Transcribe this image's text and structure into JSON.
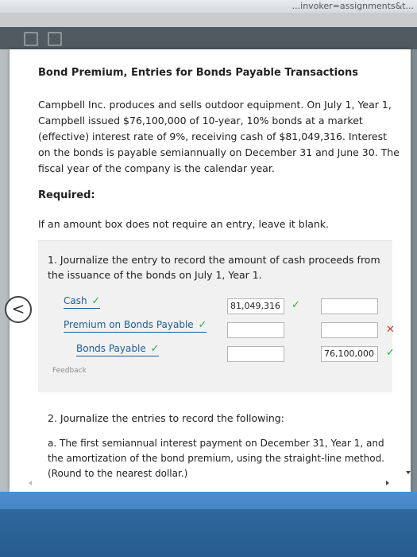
{
  "browser": {
    "url_fragment": "...invoker=assignments&t..."
  },
  "page": {
    "title": "Bond Premium, Entries for Bonds Payable Transactions",
    "problem_text": "Campbell Inc. produces and sells outdoor equipment. On July 1, Year 1, Campbell issued $76,100,000 of 10-year, 10% bonds at a market (effective) interest rate of 9%, receiving cash of $81,049,316. Interest on the bonds is payable semiannually on December 31 and June 30. The fiscal year of the company is the calendar year.",
    "required_label": "Required:",
    "note": "If an amount box does not require an entry, leave it blank."
  },
  "question1": {
    "text": "1.  Journalize the entry to record the amount of cash proceeds from the issuance of the bonds on July 1, Year 1.",
    "rows": [
      {
        "account": "Cash",
        "debit": "81,049,316",
        "credit": ""
      },
      {
        "account": "Premium on Bonds Payable",
        "debit": "",
        "credit": ""
      },
      {
        "account": "Bonds Payable",
        "debit": "",
        "credit": "76,100,000"
      }
    ],
    "feedback_label": "Feedback",
    "check_mark": "✓",
    "x_mark": "✕"
  },
  "question2": {
    "text": "2.  Journalize the entries to record the following:",
    "part_a": "a.   The first semiannual interest payment on December 31, Year 1, and the amortization of the bond premium, using the straight-line method. (Round to the nearest dollar.)"
  },
  "nav": {
    "back_glyph": "<"
  }
}
